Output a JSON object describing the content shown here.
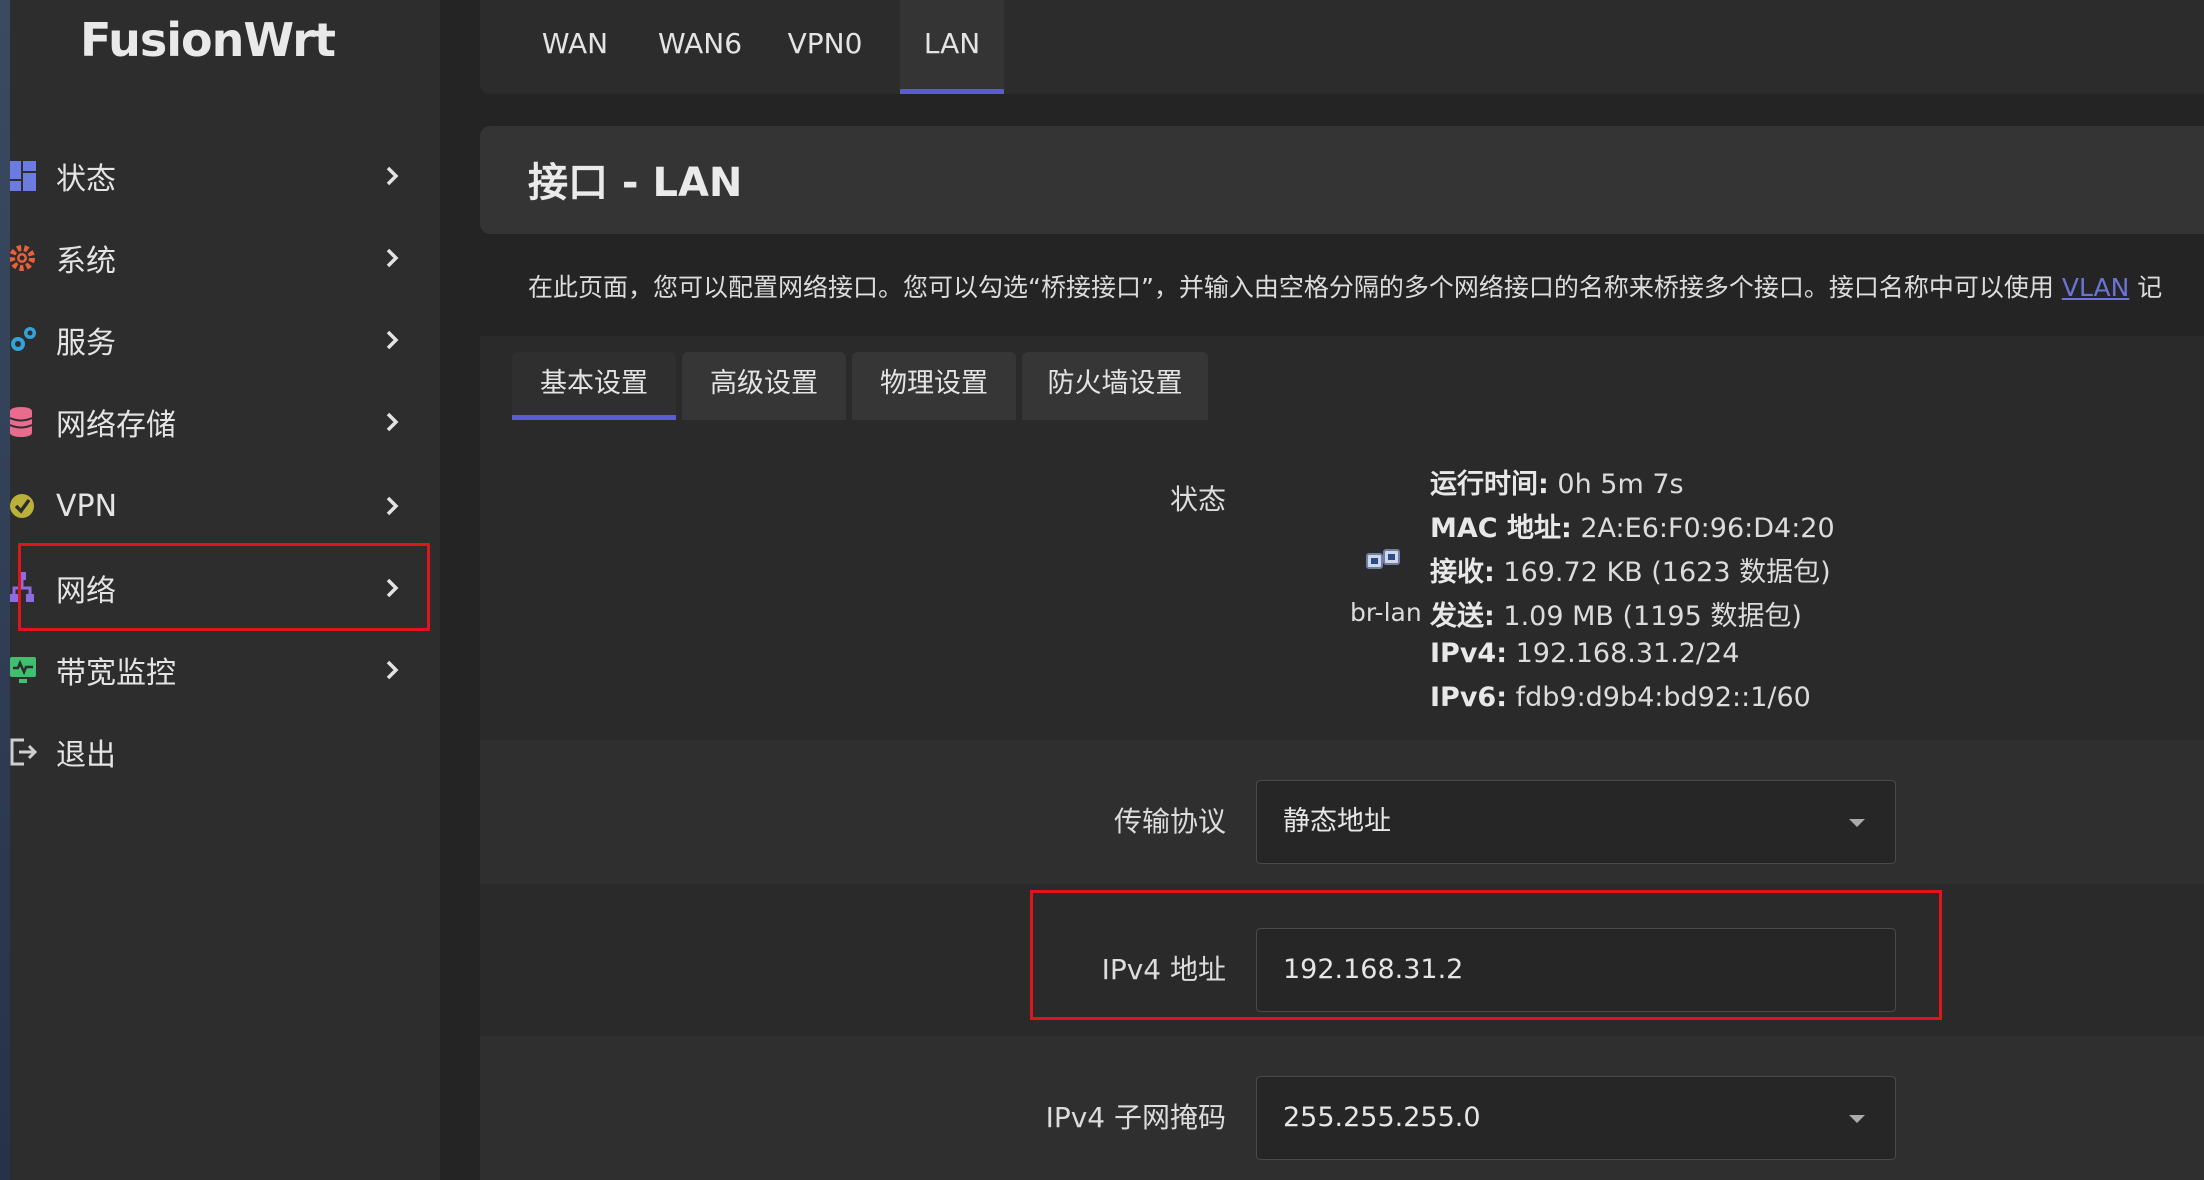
{
  "app": {
    "logo": "FusionWrt"
  },
  "sidebar": {
    "items": [
      {
        "label": "状态",
        "icon": "dashboard-icon",
        "color": "#6c7be0"
      },
      {
        "label": "系统",
        "icon": "gear-icon",
        "color": "#e8613a"
      },
      {
        "label": "服务",
        "icon": "services-icon",
        "color": "#33a3d8"
      },
      {
        "label": "网络存储",
        "icon": "database-icon",
        "color": "#e96b8e"
      },
      {
        "label": "VPN",
        "icon": "vpn-shield-icon",
        "color": "#b9b13a"
      },
      {
        "label": "网络",
        "icon": "network-icon",
        "color": "#8d6be0"
      },
      {
        "label": "带宽监控",
        "icon": "monitor-icon",
        "color": "#3fbf6f"
      },
      {
        "label": "退出",
        "icon": "logout-icon",
        "color": "#cfcfcf"
      }
    ]
  },
  "interface_tabs": [
    "WAN",
    "WAN6",
    "VPN0",
    "LAN"
  ],
  "page": {
    "title": "接口 - LAN",
    "description": "在此页面，您可以配置网络接口。您可以勾选“桥接接口”，并输入由空格分隔的多个网络接口的名称来桥接多个接口。接口名称中可以使用 ",
    "description_link": "VLAN",
    "description_tail": " 记"
  },
  "section_tabs": [
    "基本设置",
    "高级设置",
    "物理设置",
    "防火墙设置"
  ],
  "status": {
    "label": "状态",
    "iface": "br-lan",
    "lines": [
      {
        "key": "运行时间:",
        "value": " 0h 5m 7s"
      },
      {
        "key": "MAC 地址:",
        "value": " 2A:E6:F0:96:D4:20"
      },
      {
        "key": "接收:",
        "value": " 169.72 KB (1623 数据包)"
      },
      {
        "key": "发送:",
        "value": " 1.09 MB (1195 数据包)"
      },
      {
        "key": "IPv4:",
        "value": " 192.168.31.2/24"
      },
      {
        "key": "IPv6:",
        "value": " fdb9:d9b4:bd92::1/60"
      }
    ]
  },
  "fields": {
    "protocol": {
      "label": "传输协议",
      "value": "静态地址"
    },
    "ipv4_address": {
      "label": "IPv4 地址",
      "value": "192.168.31.2"
    },
    "netmask": {
      "label": "IPv4 子网掩码",
      "value": "255.255.255.0"
    }
  },
  "colors": {
    "accent": "#5b5bd6",
    "highlight": "#e0141c",
    "link": "#6b73d6"
  }
}
